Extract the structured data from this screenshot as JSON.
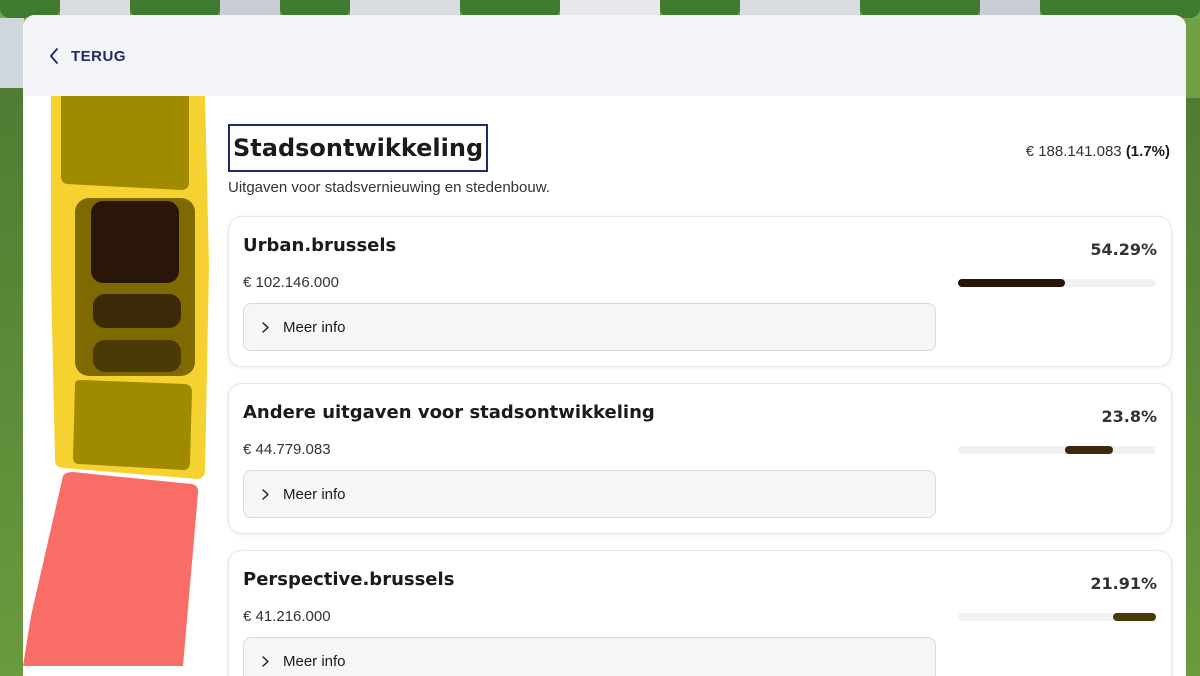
{
  "back": {
    "label": "TERUG",
    "icon": "chevron-left-icon"
  },
  "section": {
    "title": "Stadsontwikkeling",
    "subtitle": "Uitgaven voor stadsvernieuwing en stedenbouw.",
    "total_amount": "€ 188.141.083",
    "total_share": "(1.7%)"
  },
  "items": [
    {
      "name": "Urban.brussels",
      "amount": "€ 102.146.000",
      "percent_label": "54.29%",
      "start": 0.0,
      "share": 0.5429,
      "color": "#2a1608",
      "more_label": "Meer info"
    },
    {
      "name": "Andere uitgaven voor stadsontwikkeling",
      "amount": "€ 44.779.083",
      "percent_label": "23.8%",
      "start": 0.5429,
      "share": 0.238,
      "color": "#3b2a08",
      "more_label": "Meer info"
    },
    {
      "name": "Perspective.brussels",
      "amount": "€ 41.216.000",
      "percent_label": "21.91%",
      "start": 0.7809,
      "share": 0.2191,
      "color": "#4a3a06",
      "more_label": "Meer info"
    }
  ],
  "colors": {
    "accent": "#1f2a6b",
    "highlight_yellow": "#f5d230",
    "highlight_olive": "#a08a00",
    "segment_dark": "#2a1608",
    "segment_coral": "#f86e66"
  }
}
